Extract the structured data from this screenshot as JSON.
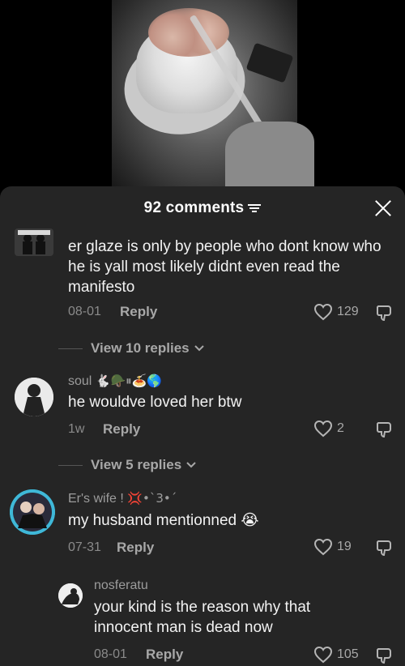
{
  "sheet": {
    "comments_label": "92 comments"
  },
  "comments": [
    {
      "username": "",
      "text": "er glaze is only by people who dont know who he is yall most likely didnt even read the manifesto",
      "date": "08-01",
      "reply_label": "Reply",
      "likes": "129",
      "view_replies": "View 10 replies"
    },
    {
      "username": "soul",
      "username_emoji": "🐇🪖⏸🍝🌎",
      "text": "he wouldve loved her btw",
      "date": "1w",
      "reply_label": "Reply",
      "likes": "2",
      "view_replies": "View 5 replies"
    },
    {
      "username": "Er's wife !",
      "username_emoji": "💢•`3•´",
      "text": "my husband mentionned 😭",
      "date": "07-31",
      "reply_label": "Reply",
      "likes": "19"
    },
    {
      "username": "nosferatu",
      "text": "your kind is the reason why that innocent man is dead now",
      "date": "08-01",
      "reply_label": "Reply",
      "likes": "105"
    }
  ],
  "colors": {
    "sheet_bg": "#252525",
    "text_primary": "#f2f2f2",
    "text_secondary": "#8a8a8a"
  },
  "icons": [
    "filter-icon",
    "close-icon",
    "heart-icon",
    "dislike-icon",
    "chevron-down-icon"
  ]
}
